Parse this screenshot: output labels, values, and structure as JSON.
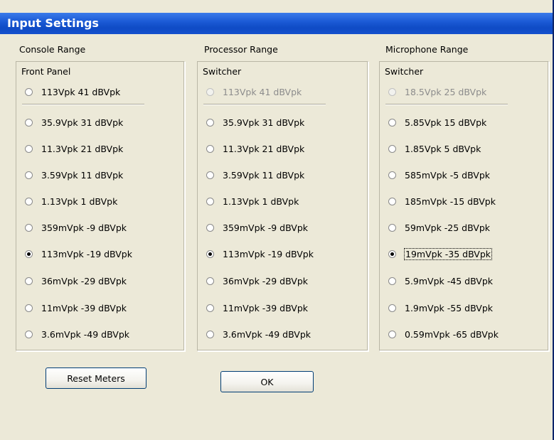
{
  "window": {
    "title": "Input Settings"
  },
  "columns": [
    {
      "header": "Console Range",
      "group_label": "Front Panel",
      "options": [
        {
          "label": "113Vpk 41 dBVpk",
          "checked": false,
          "disabled": false
        },
        {
          "label": "35.9Vpk 31 dBVpk",
          "checked": false,
          "disabled": false
        },
        {
          "label": "11.3Vpk 21 dBVpk",
          "checked": false,
          "disabled": false
        },
        {
          "label": "3.59Vpk 11 dBVpk",
          "checked": false,
          "disabled": false
        },
        {
          "label": "1.13Vpk 1 dBVpk",
          "checked": false,
          "disabled": false
        },
        {
          "label": "359mVpk -9 dBVpk",
          "checked": false,
          "disabled": false
        },
        {
          "label": "113mVpk -19 dBVpk",
          "checked": true,
          "disabled": false
        },
        {
          "label": "36mVpk -29 dBVpk",
          "checked": false,
          "disabled": false
        },
        {
          "label": "11mVpk -39 dBVpk",
          "checked": false,
          "disabled": false
        },
        {
          "label": "3.6mVpk -49 dBVpk",
          "checked": false,
          "disabled": false
        }
      ]
    },
    {
      "header": "Processor Range",
      "group_label": "Switcher",
      "options": [
        {
          "label": "113Vpk 41 dBVpk",
          "checked": false,
          "disabled": true
        },
        {
          "label": "35.9Vpk 31 dBVpk",
          "checked": false,
          "disabled": false
        },
        {
          "label": "11.3Vpk 21 dBVpk",
          "checked": false,
          "disabled": false
        },
        {
          "label": "3.59Vpk 11 dBVpk",
          "checked": false,
          "disabled": false
        },
        {
          "label": "1.13Vpk 1 dBVpk",
          "checked": false,
          "disabled": false
        },
        {
          "label": "359mVpk -9 dBVpk",
          "checked": false,
          "disabled": false
        },
        {
          "label": "113mVpk -19 dBVpk",
          "checked": true,
          "disabled": false
        },
        {
          "label": "36mVpk -29 dBVpk",
          "checked": false,
          "disabled": false
        },
        {
          "label": "11mVpk -39 dBVpk",
          "checked": false,
          "disabled": false
        },
        {
          "label": "3.6mVpk -49 dBVpk",
          "checked": false,
          "disabled": false
        }
      ]
    },
    {
      "header": "Microphone Range",
      "group_label": "Switcher",
      "options": [
        {
          "label": "18.5Vpk 25 dBVpk",
          "checked": false,
          "disabled": true
        },
        {
          "label": "5.85Vpk 15 dBVpk",
          "checked": false,
          "disabled": false
        },
        {
          "label": "1.85Vpk 5 dBVpk",
          "checked": false,
          "disabled": false
        },
        {
          "label": "585mVpk -5 dBVpk",
          "checked": false,
          "disabled": false
        },
        {
          "label": "185mVpk -15 dBVpk",
          "checked": false,
          "disabled": false
        },
        {
          "label": "59mVpk -25 dBVpk",
          "checked": false,
          "disabled": false
        },
        {
          "label": "19mVpk -35 dBVpk",
          "checked": true,
          "disabled": false,
          "focused": true
        },
        {
          "label": "5.9mVpk -45 dBVpk",
          "checked": false,
          "disabled": false
        },
        {
          "label": "1.9mVpk -55 dBVpk",
          "checked": false,
          "disabled": false
        },
        {
          "label": "0.59mVpk -65 dBVpk",
          "checked": false,
          "disabled": false
        }
      ]
    }
  ],
  "buttons": {
    "reset_label": "Reset Meters",
    "ok_label": "OK"
  }
}
